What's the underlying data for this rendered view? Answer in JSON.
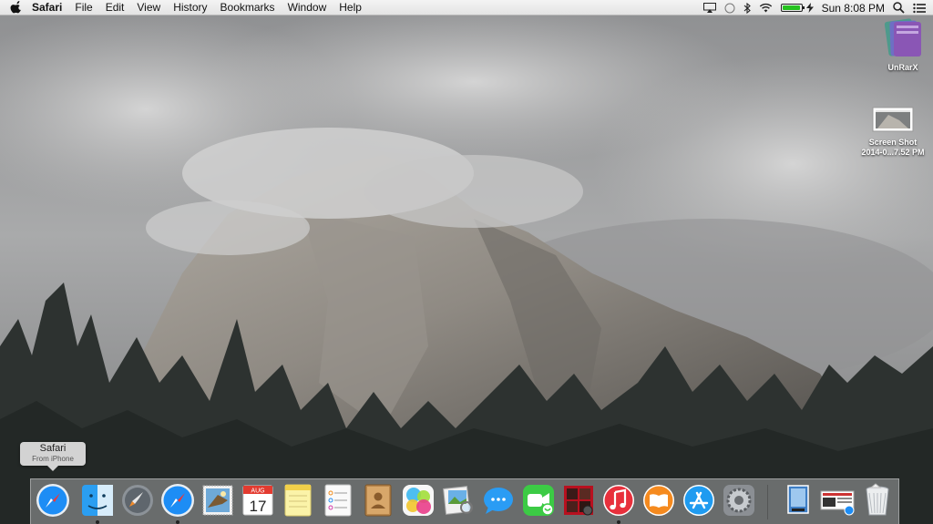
{
  "menubar": {
    "app_name": "Safari",
    "menus": [
      "File",
      "Edit",
      "View",
      "History",
      "Bookmarks",
      "Window",
      "Help"
    ],
    "clock": "Sun 8:08 PM",
    "battery_level": 0.86,
    "status_icons": [
      "airplay-icon",
      "notification-dot-icon",
      "bluetooth-icon",
      "wifi-icon",
      "battery-icon",
      "search-icon",
      "notification-center-icon"
    ]
  },
  "desktop": {
    "icons": [
      {
        "label": "UnRarX"
      },
      {
        "label_line1": "Screen Shot",
        "label_line2": "2014-0...7.52 PM"
      }
    ]
  },
  "tooltip": {
    "title": "Safari",
    "subtitle": "From iPhone"
  },
  "dock": {
    "handoff_app": "Safari",
    "calendar": {
      "month": "AUG",
      "day": "17"
    },
    "items": [
      "safari-handoff",
      "finder",
      "launchpad",
      "safari",
      "mail",
      "calendar",
      "notes",
      "reminders",
      "contacts",
      "game-center",
      "preview",
      "messages",
      "facetime",
      "photo-booth",
      "itunes",
      "ibooks",
      "app-store",
      "system-preferences",
      "downloads-stack",
      "document-stack",
      "trash"
    ],
    "colors": {
      "accent_blue": "#1d8df5",
      "itunes_red": "#e8303c",
      "ibooks_orange": "#f58a1f",
      "facetime_green": "#3ccb45"
    }
  }
}
